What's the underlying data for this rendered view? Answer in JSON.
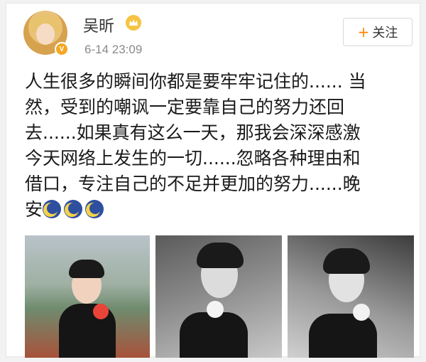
{
  "user": {
    "name": "吴昕",
    "timestamp": "6-14 23:09"
  },
  "follow_label": "关注",
  "post": {
    "lines": [
      "人生很多的瞬间你都是要牢牢记住的...... 当",
      "然，受到的嘲讽一定要靠自己的努力还回",
      "去......如果真有这么一天，那我会深深感激",
      "今天网络上发生的一切......忽略各种理由和",
      "借口，专注自己的不足并更加的努力......晚",
      "安"
    ],
    "emoji": [
      "moon-face-icon",
      "moon-face-icon",
      "moon-face-icon"
    ]
  },
  "colors": {
    "accent": "#ff8200",
    "badge": "#f5a623",
    "text": "#1a1a1a",
    "meta": "#8a8a8a"
  },
  "photos": [
    "photo-1",
    "photo-2",
    "photo-3"
  ]
}
